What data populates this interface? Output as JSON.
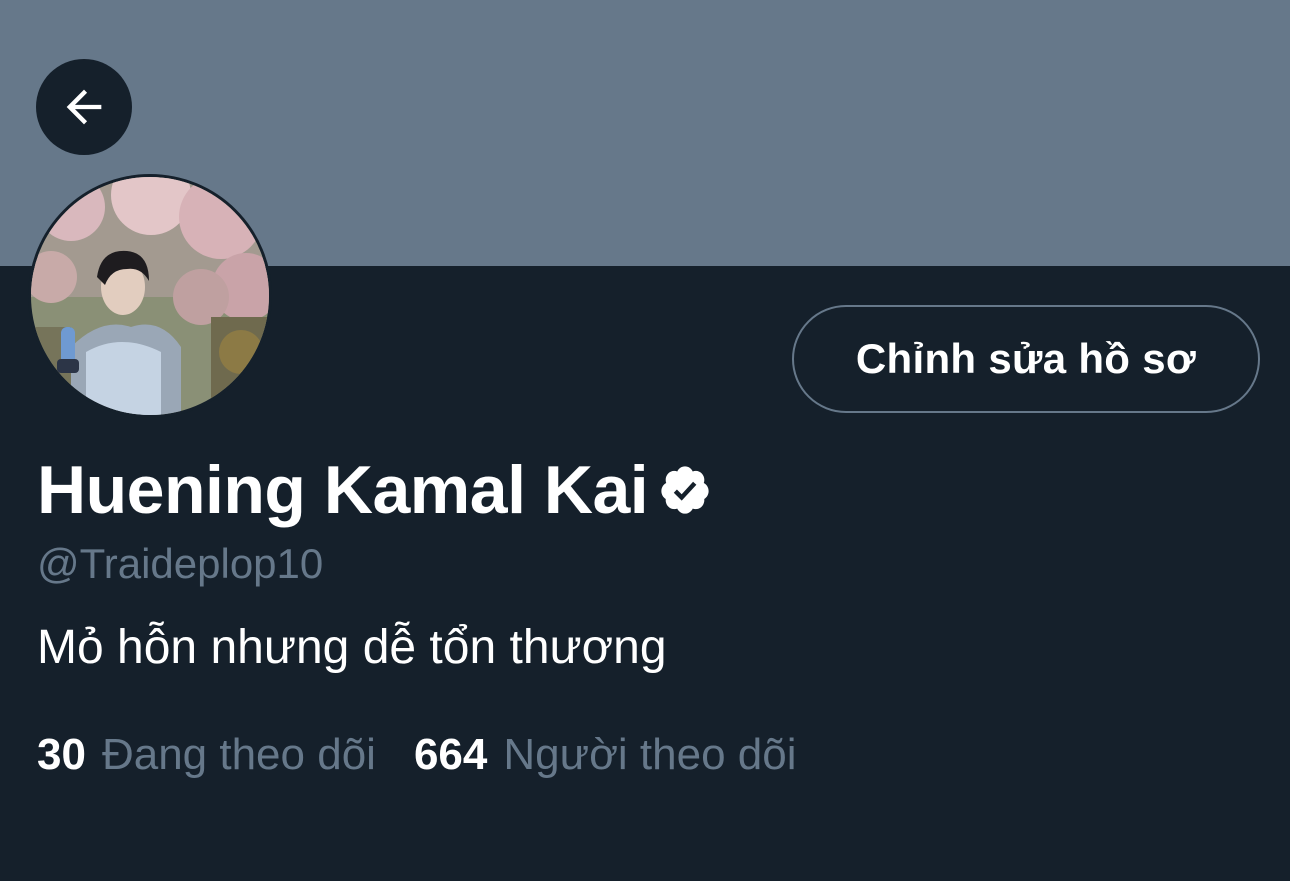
{
  "header": {
    "back_icon": "arrow-left-icon",
    "banner_color": "#66788a"
  },
  "profile": {
    "display_name": "Huening Kamal Kai",
    "verified_icon": "verified-badge-icon",
    "handle": "@Traideplop10",
    "bio": "Mỏ hỗn nhưng dễ tổn thương",
    "edit_button_label": "Chỉnh sửa hồ sơ"
  },
  "stats": {
    "following_count": "30",
    "following_label": "Đang theo dõi",
    "followers_count": "664",
    "followers_label": "Người theo dõi"
  },
  "colors": {
    "background": "#15202b",
    "text_primary": "#ffffff",
    "text_secondary": "#66788a",
    "border": "#66788a"
  }
}
